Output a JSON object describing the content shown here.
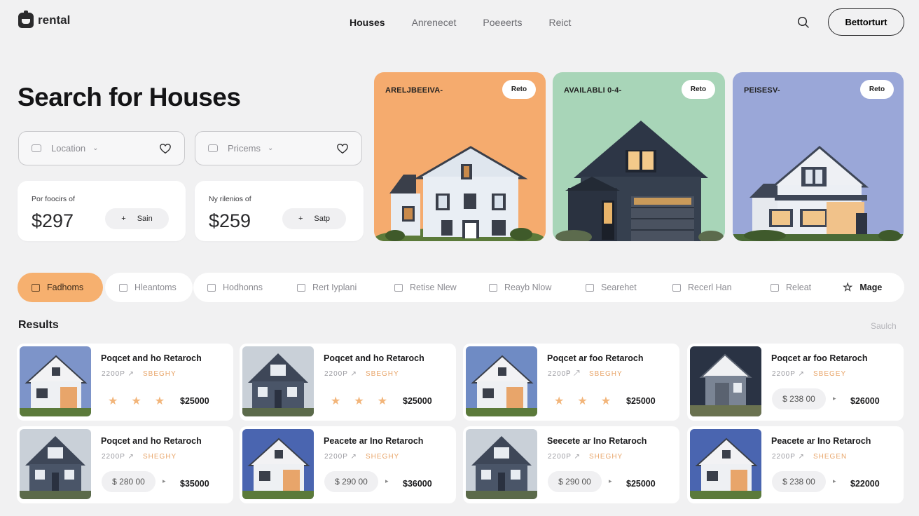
{
  "app": {
    "name": "rental"
  },
  "nav": {
    "items": [
      "Houses",
      "Anrenecet",
      "Poeeerts",
      "Reict"
    ],
    "active_index": 0
  },
  "header": {
    "cta_label": "Bettorturt",
    "search_icon": "search-icon"
  },
  "hero": {
    "title": "Search for Houses",
    "filters": [
      {
        "placeholder": "Location",
        "icon": "location-icon"
      },
      {
        "placeholder": "Pricems",
        "icon": "price-icon"
      }
    ],
    "stats": [
      {
        "label": "Por foocirs of",
        "value": "$297",
        "button": "Sain"
      },
      {
        "label": "Ny rilenios of",
        "value": "$259",
        "button": "Satp"
      }
    ]
  },
  "featured": [
    {
      "label": "ARELJBEEIVA-",
      "badge": "Reto",
      "color": "#f5ab6e"
    },
    {
      "label": "AVAILABLI 0-4-",
      "badge": "Reto",
      "color": "#a8d5b8"
    },
    {
      "label": "PEISESV-",
      "badge": "Reto",
      "color": "#9aa7d8"
    }
  ],
  "categories": [
    {
      "label": "Fadhoms",
      "icon": "camera-icon",
      "active": true
    },
    {
      "label": "Hleantoms",
      "icon": "folder-icon"
    },
    {
      "label": "Hodhonns",
      "icon": "folder-icon"
    },
    {
      "label": "Rert Iyplani",
      "icon": "doc-icon"
    },
    {
      "label": "Retise Nlew",
      "icon": "chat-icon"
    },
    {
      "label": "Reayb Nlow",
      "icon": "doc-icon"
    },
    {
      "label": "Searehet",
      "icon": "doc-icon"
    },
    {
      "label": "Recerl Han",
      "icon": "doc-icon"
    },
    {
      "label": "Releat",
      "icon": "doc-icon"
    },
    {
      "label": "Mage",
      "icon": "star-outline-icon"
    }
  ],
  "results": {
    "title": "Results",
    "link": "Saulch",
    "items": [
      {
        "title": "Poqcet and ho Retaroch",
        "meta_a": "2200P ↗",
        "meta_b": "SBEGHY",
        "rating": 3,
        "price": "$25000"
      },
      {
        "title": "Poqcet and ho Retaroch",
        "meta_a": "2200P ↗",
        "meta_b": "SBEGHY",
        "rating": 3,
        "price": "$25000"
      },
      {
        "title": "Poqcet ar foo Retaroch",
        "meta_a": "2200Ꮲ ↗",
        "meta_b": "SBEGHY",
        "rating": 3,
        "price": "$25000"
      },
      {
        "title": "Poqcet ar foo Retaroch",
        "meta_a": "2200P ↗",
        "meta_b": "SBEGEY",
        "pill": "$ 238 00",
        "price": "$26000"
      },
      {
        "title": "Poqcet and ho Retaroch",
        "meta_a": "2200P ↗",
        "meta_b": "SHEGHY",
        "pill": "$ 280 00",
        "price": "$35000"
      },
      {
        "title": "Peacete ar Ino Retaroch",
        "meta_a": "2200P ↗",
        "meta_b": "SHEGHY",
        "pill": "$ 290 00",
        "price": "$36000"
      },
      {
        "title": "Seecete ar Ino Retaroch",
        "meta_a": "2200P ↗",
        "meta_b": "SHEGHY",
        "pill": "$ 290 00",
        "price": "$25000"
      },
      {
        "title": "Peacete ar Ino Retaroch",
        "meta_a": "2200P ↗",
        "meta_b": "SHEGEN",
        "pill": "$ 238 00",
        "price": "$22000"
      }
    ]
  }
}
